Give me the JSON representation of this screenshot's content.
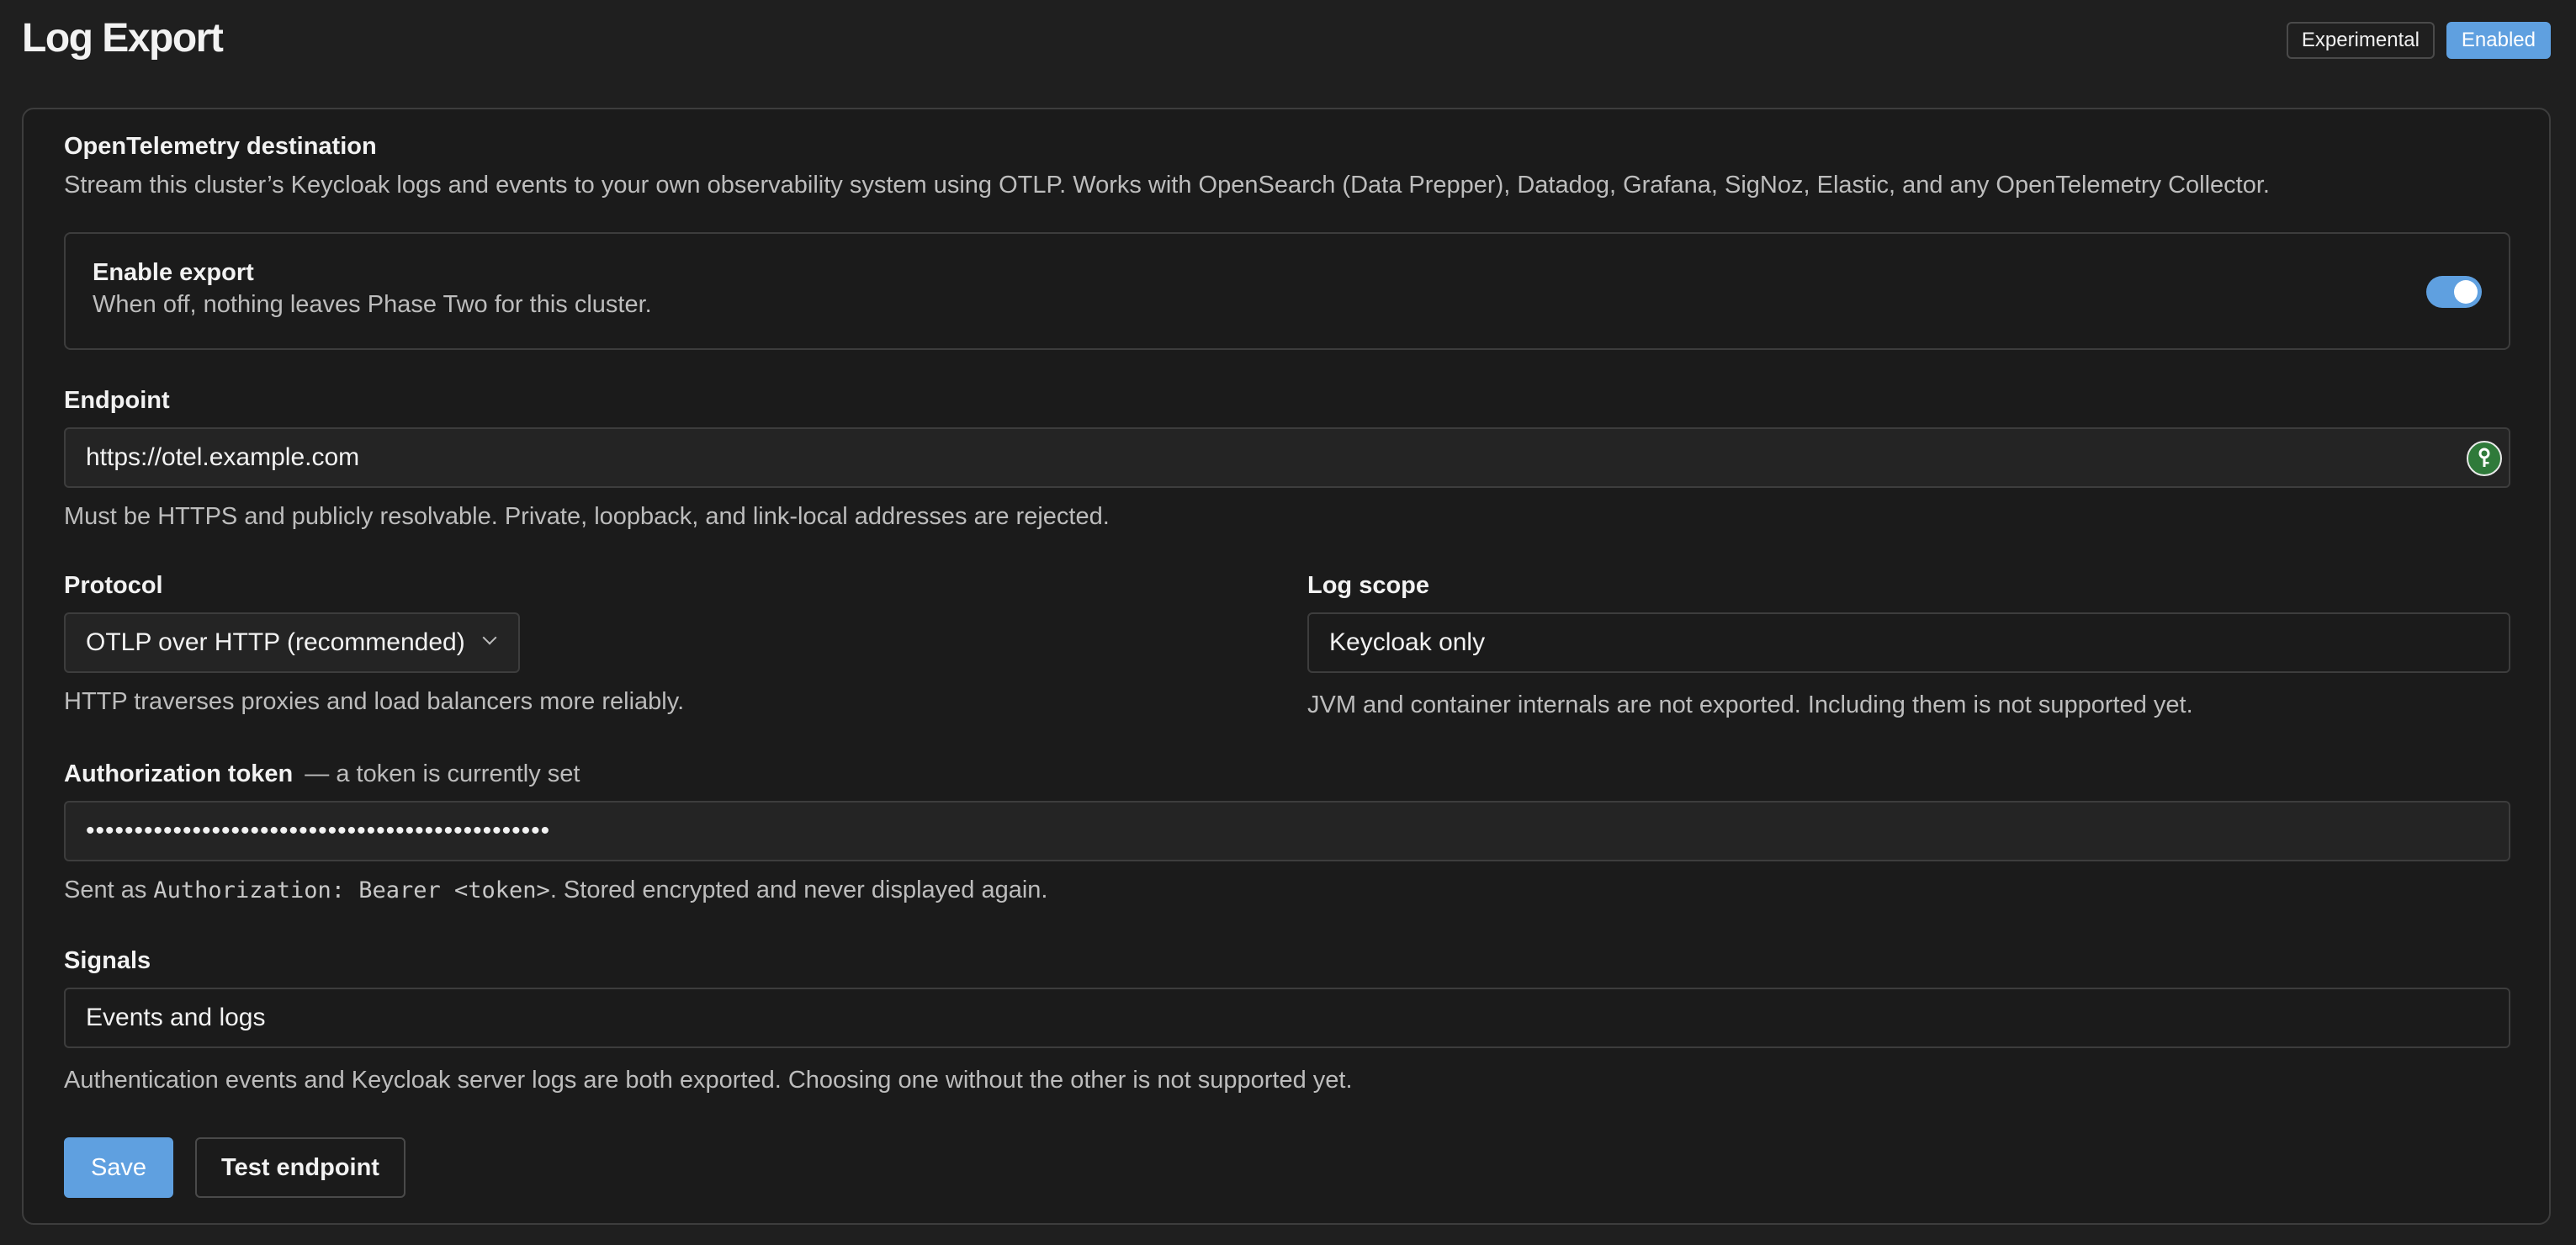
{
  "page": {
    "title": "Log Export"
  },
  "badges": {
    "experimental": "Experimental",
    "enabled": "Enabled"
  },
  "destination": {
    "title": "OpenTelemetry destination",
    "description": "Stream this cluster’s Keycloak logs and events to your own observability system using OTLP. Works with OpenSearch (Data Prepper), Datadog, Grafana, SigNoz, Elastic, and any OpenTelemetry Collector."
  },
  "enable_export": {
    "title": "Enable export",
    "description": "When off, nothing leaves Phase Two for this cluster.",
    "on": true
  },
  "endpoint": {
    "label": "Endpoint",
    "value": "https://otel.example.com",
    "help": "Must be HTTPS and publicly resolvable. Private, loopback, and link-local addresses are rejected.",
    "icon": "password-manager-key-icon"
  },
  "protocol": {
    "label": "Protocol",
    "selected": "OTLP over HTTP (recommended)",
    "help": "HTTP traverses proxies and load balancers more reliably."
  },
  "log_scope": {
    "label": "Log scope",
    "value": "Keycloak only",
    "help": "JVM and container internals are not exported. Including them is not supported yet."
  },
  "auth_token": {
    "label": "Authorization token",
    "status": "— a token is currently set",
    "value": "••••••••••••••••••••••••••••••••••••••••••••••••",
    "help_prefix": "Sent as ",
    "help_code": "Authorization: Bearer <token>",
    "help_suffix": ". Stored encrypted and never displayed again."
  },
  "signals": {
    "label": "Signals",
    "value": "Events and logs",
    "help": "Authentication events and Keycloak server logs are both exported. Choosing one without the other is not supported yet."
  },
  "actions": {
    "save": "Save",
    "test": "Test endpoint"
  },
  "colors": {
    "accent": "#5fa0e0",
    "background": "#1f1f1f",
    "border": "#3d3d3d"
  }
}
